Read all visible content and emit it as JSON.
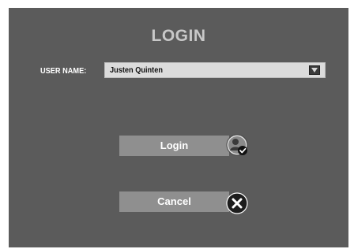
{
  "login": {
    "title": "LOGIN",
    "user_name_label": "USER NAME:",
    "user_name_value": "Justen Quinten",
    "login_button": "Login",
    "cancel_button": "Cancel"
  },
  "icons": {
    "dropdown": "dropdown-arrow-icon",
    "login": "user-login-check-icon",
    "cancel": "cancel-x-icon"
  },
  "colors": {
    "panel_bg": "#5b5b5b",
    "button_bg": "#8f8f8f",
    "select_bg": "#dcdcdc",
    "title": "#c8c8c8"
  }
}
